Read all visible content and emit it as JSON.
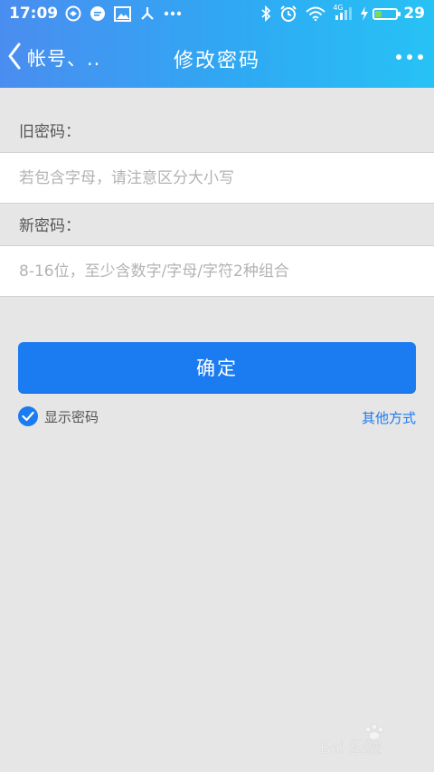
{
  "status_bar": {
    "time": "17:09",
    "network_label": "4G",
    "battery_percent": "29",
    "battery_level": 0.29,
    "colors": {
      "battery_fill": "#7ed957"
    },
    "left_icons": [
      "sync-icon",
      "chat-icon",
      "image-icon",
      "share-icon",
      "more-dots-icon"
    ],
    "right_icons": [
      "bluetooth-icon",
      "alarm-icon",
      "wifi-icon",
      "signal-icon",
      "charging-icon",
      "battery-icon"
    ]
  },
  "navbar": {
    "back_label": "帐号、..",
    "title": "修改密码",
    "more_icon": "more-horizontal-icon"
  },
  "form": {
    "old_password": {
      "label": "旧密码：",
      "value": "",
      "placeholder": "若包含字母，请注意区分大小写"
    },
    "new_password": {
      "label": "新密码：",
      "value": "",
      "placeholder": "8-16位，至少含数字/字母/字符2种组合"
    },
    "confirm_label": "确定",
    "show_password_label": "显示密码",
    "show_password_checked": true,
    "other_methods_label": "其他方式"
  },
  "colors": {
    "primary": "#1b7bf0",
    "header_gradient_start": "#4a8df0",
    "header_gradient_end": "#27c2f5",
    "background": "#e6e6e6"
  },
  "watermark": {
    "label": "Baidu经验"
  }
}
